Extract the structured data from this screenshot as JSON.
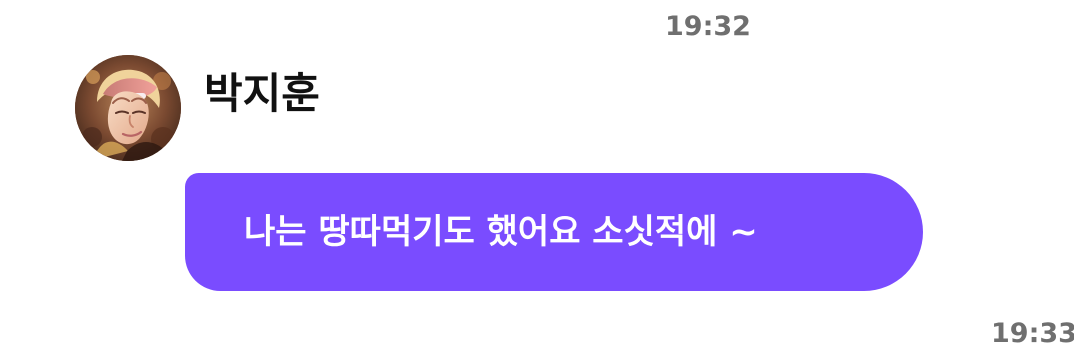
{
  "timestamps": {
    "first": "19:32",
    "second": "19:33"
  },
  "message": {
    "sender": "박지훈",
    "text": "나는 땅따먹기도 했어요 소싯적에 ~"
  },
  "avatar": {
    "icon": "user-profile-photo-icon",
    "background_color": "#7b4a31",
    "accent_color": "#f2c7a6"
  },
  "bubble": {
    "color": "#7a4cff"
  }
}
